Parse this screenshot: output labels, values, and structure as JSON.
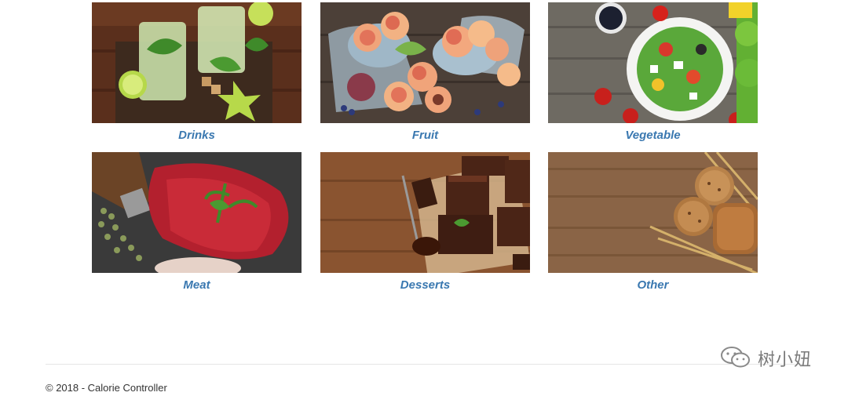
{
  "categories": [
    {
      "label": "Drinks"
    },
    {
      "label": "Fruit"
    },
    {
      "label": "Vegetable"
    },
    {
      "label": "Meat"
    },
    {
      "label": "Desserts"
    },
    {
      "label": "Other"
    }
  ],
  "footer": {
    "copyright": "© 2018 - Calorie Controller"
  },
  "watermark": {
    "text": "树小妞",
    "icon": "wechat-icon"
  },
  "colors": {
    "link": "#3a78b0",
    "footer_text": "#333333",
    "rule": "#e6e6e6"
  }
}
